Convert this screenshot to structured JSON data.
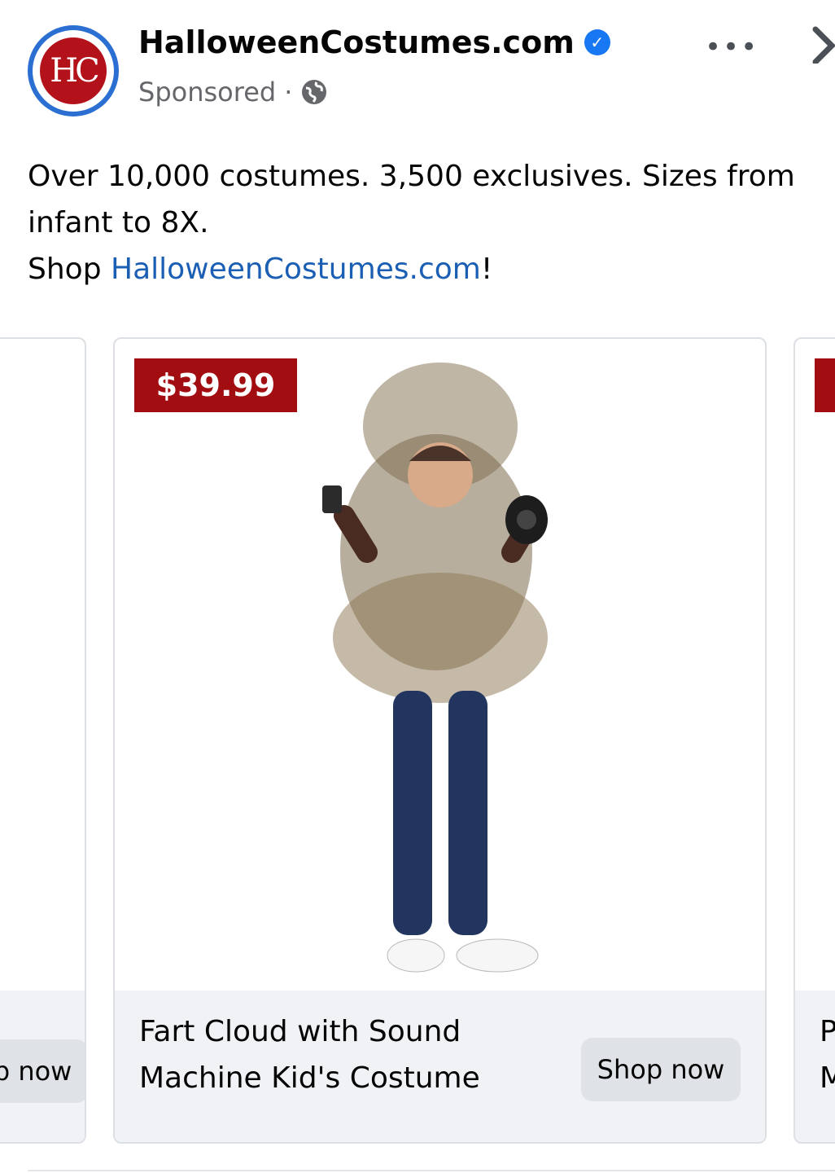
{
  "post": {
    "brand_name": "HalloweenCostumes.com",
    "avatar_text": "HC",
    "sponsored_label": "Sponsored",
    "separator": "·",
    "message_line1": "Over 10,000 costumes. 3,500 exclusives. Sizes from infant to 8X.",
    "message_shop_prefix": "Shop ",
    "message_link": "HalloweenCostumes.com",
    "message_suffix": "!"
  },
  "header_actions": {
    "more_label": "•••",
    "close_icon": "close-icon",
    "more_icon": "more-options-icon"
  },
  "carousel": {
    "left_card": {
      "button_label": "Shop now"
    },
    "main_card": {
      "price": "$39.99",
      "title": "Fart Cloud with Sound Machine Kid's Costume",
      "button_label": "Shop now"
    },
    "right_card": {
      "title_peek": "P\nM"
    }
  },
  "colors": {
    "price_tag": "#a10d10",
    "link": "#1a5fb4",
    "verified": "#1877f2",
    "footer_bg": "#f0f2f5"
  }
}
